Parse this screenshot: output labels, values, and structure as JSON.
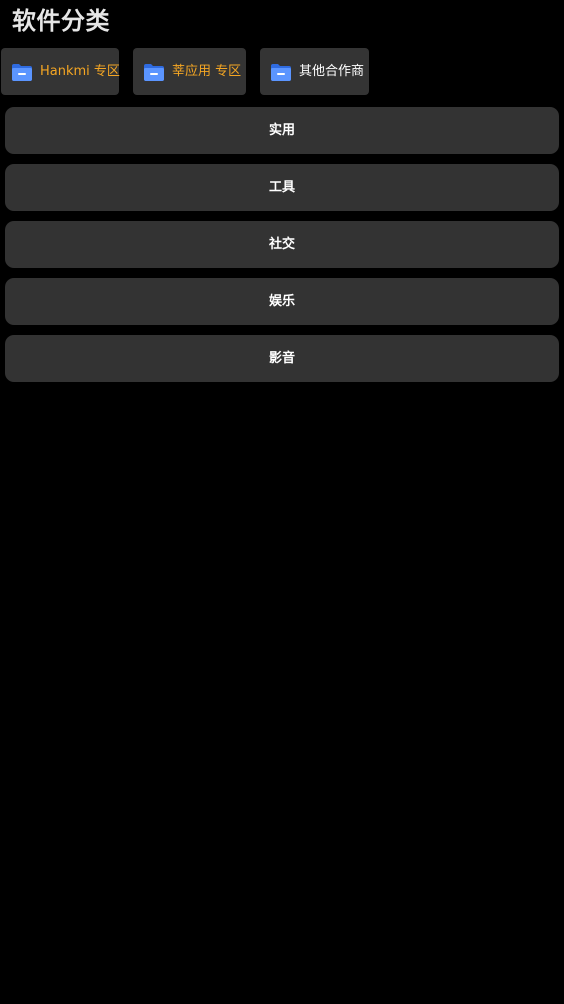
{
  "header": {
    "title": "软件分类"
  },
  "folders": [
    {
      "label": "Hankmi 专区",
      "color": "#f5a623",
      "icon": "folder-icon"
    },
    {
      "label": "莘应用 专区",
      "color": "#f5a623",
      "icon": "folder-icon"
    },
    {
      "label": "其他合作商",
      "color": "#ffffff",
      "icon": "folder-icon"
    }
  ],
  "categories": [
    {
      "label": "实用"
    },
    {
      "label": "工具"
    },
    {
      "label": "社交"
    },
    {
      "label": "娱乐"
    },
    {
      "label": "影音"
    }
  ],
  "colors": {
    "background": "#000000",
    "card": "#333333",
    "accent_orange": "#f5a623",
    "folder_blue": "#3d7bf5"
  }
}
